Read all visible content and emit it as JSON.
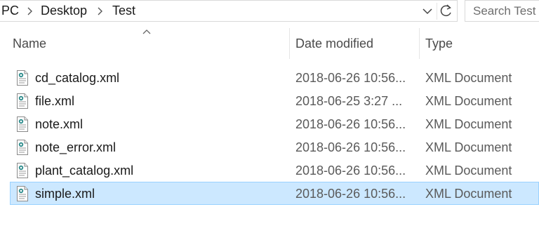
{
  "address_bar": {
    "crumbs": [
      "PC",
      "Desktop",
      "Test"
    ]
  },
  "search": {
    "placeholder": "Search Test"
  },
  "columns": {
    "name": "Name",
    "date_modified": "Date modified",
    "type": "Type"
  },
  "files": [
    {
      "name": "cd_catalog.xml",
      "date": "2018-06-26 10:56...",
      "type": "XML Document",
      "selected": false
    },
    {
      "name": "file.xml",
      "date": "2018-06-25 3:27 ...",
      "type": "XML Document",
      "selected": false
    },
    {
      "name": "note.xml",
      "date": "2018-06-26 10:56...",
      "type": "XML Document",
      "selected": false
    },
    {
      "name": "note_error.xml",
      "date": "2018-06-26 10:56...",
      "type": "XML Document",
      "selected": false
    },
    {
      "name": "plant_catalog.xml",
      "date": "2018-06-26 10:56...",
      "type": "XML Document",
      "selected": false
    },
    {
      "name": "simple.xml",
      "date": "2018-06-26 10:56...",
      "type": "XML Document",
      "selected": true
    }
  ],
  "colors": {
    "selection_bg": "#cce8ff",
    "selection_border": "#99d1ff"
  },
  "icons": {
    "file": "xml-document-icon",
    "breadcrumb_separator": "chevron-right-icon",
    "address_dropdown": "chevron-down-icon",
    "refresh": "refresh-icon",
    "sort": "sort-ascending-icon"
  }
}
